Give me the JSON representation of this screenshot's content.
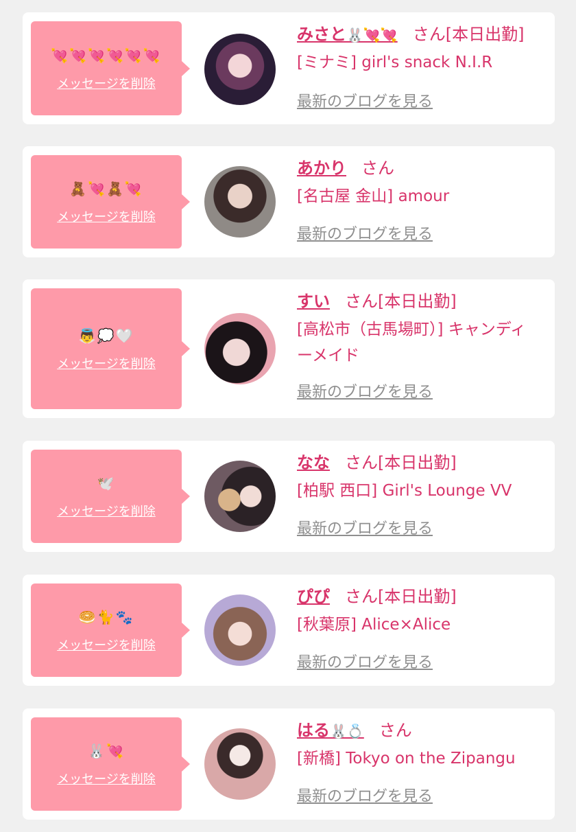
{
  "delete_label": "メッセージを削除",
  "blog_label": "最新のブログを見る",
  "colors": {
    "background": "#f0f0f0",
    "card": "#ffffff",
    "bubble": "#fe9aa9",
    "accent": "#d8346a",
    "muted": "#8f8f8f"
  },
  "entries": [
    {
      "emoji": "💘💘💘💘💘💘",
      "name": "みさと",
      "name_emoji": "🐰💘💘",
      "suffix": "さん[本日出勤]",
      "shop": "[ミナミ] girl's snack N.I.R"
    },
    {
      "emoji": "🧸💘🧸💘",
      "name": "あかり",
      "name_emoji": "",
      "suffix": "さん",
      "shop": "[名古屋 金山] amour"
    },
    {
      "emoji": "👼💭🤍",
      "name": "すい",
      "name_emoji": "",
      "suffix": "さん[本日出勤]",
      "shop": "[高松市（古馬場町）] キャンディーメイド"
    },
    {
      "emoji": "🕊️",
      "name": "なな",
      "name_emoji": "",
      "suffix": "さん[本日出勤]",
      "shop": "[柏駅 西口] Girl's Lounge VV"
    },
    {
      "emoji": "🥯🐈🐾",
      "name": "ぴぴ",
      "name_emoji": "",
      "suffix": "さん[本日出勤]",
      "shop": "[秋葉原] Alice×Alice"
    },
    {
      "emoji": "🐰💘",
      "name": "はる",
      "name_emoji": "🐰💍",
      "suffix": "さん",
      "shop": "[新橋] Tokyo on the Zipangu"
    }
  ]
}
